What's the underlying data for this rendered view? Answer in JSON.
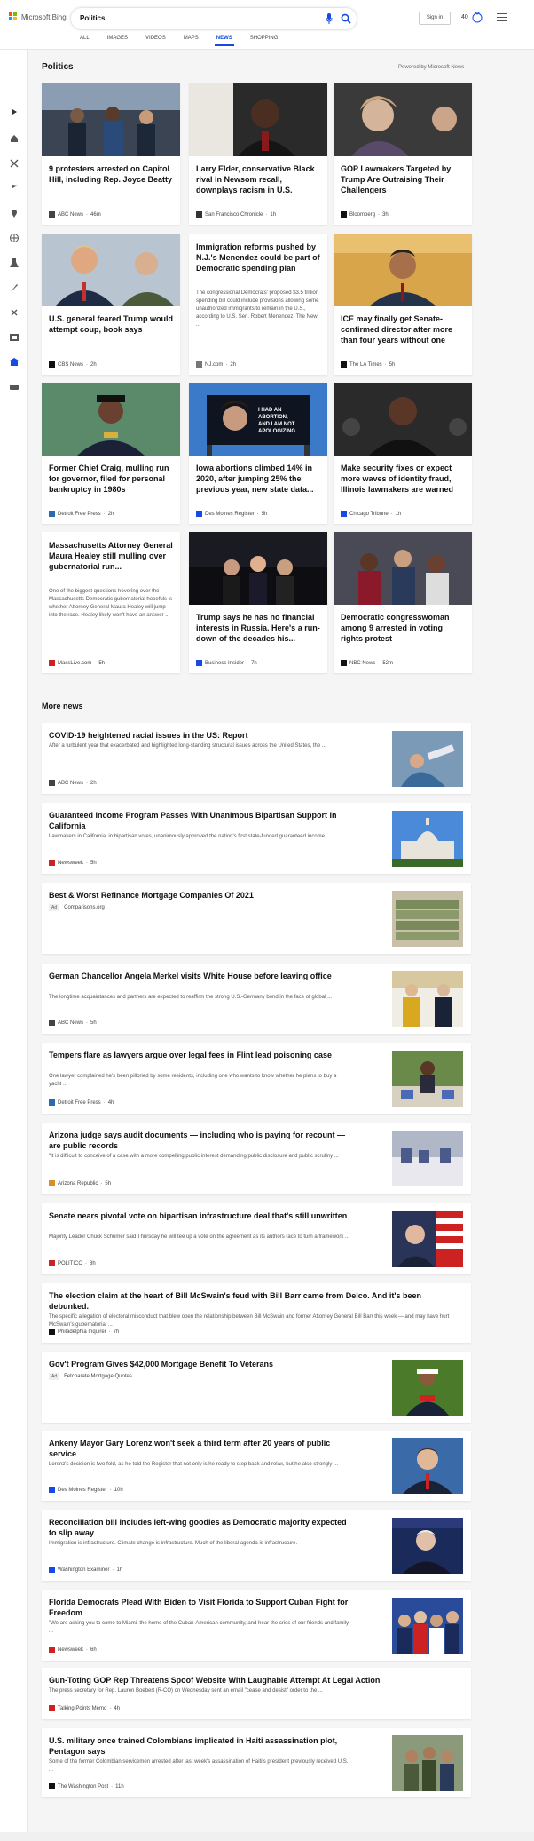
{
  "header": {
    "brand": "Microsoft Bing",
    "query": "Politics",
    "signin": "Sign in",
    "points": "40",
    "tabs": [
      "ALL",
      "IMAGES",
      "VIDEOS",
      "MAPS",
      "NEWS",
      "SHOPPING"
    ],
    "active_tab": "NEWS"
  },
  "colors": {
    "accent": "#174ae4"
  },
  "sidebar_icons": [
    "arrow-right-icon",
    "home-icon",
    "world-icon",
    "flag-icon",
    "location-icon",
    "globe-icon",
    "science-icon",
    "rocket-icon",
    "sports-icon",
    "tv-icon",
    "politics-icon",
    "money-icon"
  ],
  "section": {
    "title": "Politics",
    "powered": "Powered by Microsoft News"
  },
  "cards": [
    {
      "title": "9 protesters arrested on Capitol Hill, including Rep. Joyce Beatty",
      "source": "ABC News",
      "time": "46m"
    },
    {
      "title": "Larry Elder, conservative Black rival in Newsom recall, downplays racism in U.S.",
      "source": "San Francisco Chronicle",
      "time": "1h"
    },
    {
      "title": "GOP Lawmakers Targeted by Trump Are Outraising Their Challengers",
      "source": "Bloomberg",
      "time": "3h"
    },
    {
      "title": "U.S. general feared Trump would attempt coup, book says",
      "source": "CBS News",
      "time": "2h"
    },
    {
      "title": "Immigration reforms pushed by N.J.'s Menendez could be part of Democratic spending plan",
      "snippet": "The congressional Democrats' proposed $3.5 trillion spending bill could include provisions allowing some unauthorized immigrants to remain in the U.S., according to U.S. Sen. Robert Menendez. The New ...",
      "source": "NJ.com",
      "time": "2h"
    },
    {
      "title": "ICE may finally get Senate-confirmed director after more than four years without one",
      "source": "The LA Times",
      "time": "5h"
    },
    {
      "title": "Former Chief Craig, mulling run for governor, filed for personal bankruptcy in 1980s",
      "source": "Detroit Free Press",
      "time": "2h"
    },
    {
      "title": "Iowa abortions climbed 14% in 2020, after jumping 25% the previous year, new state data...",
      "source": "Des Moines Register",
      "time": "5h",
      "billboard": "I HAD AN ABORTION, AND I AM NOT APOLOGIZING."
    },
    {
      "title": "Make security fixes or expect more waves of identity fraud, Illinois lawmakers are warned",
      "source": "Chicago Tribune",
      "time": "1h"
    },
    {
      "title": "Massachusetts Attorney General Maura Healey still mulling over gubernatorial run...",
      "snippet": "One of the biggest questions hovering over the Massachusetts Democratic gubernatorial hopefuls is whether Attorney General Maura Healey will jump into the race. Healey likely won't have an answer ...",
      "source": "MassLive.com",
      "time": "5h"
    },
    {
      "title": "Trump says he has no financial interests in Russia. Here's a run-down of the decades his...",
      "source": "Business Insider",
      "time": "7h"
    },
    {
      "title": "Democratic congresswoman among 9 arrested in voting rights protest",
      "source": "NBC News",
      "time": "52m"
    }
  ],
  "more_news": {
    "title": "More news",
    "items": [
      {
        "title": "COVID-19 heightened racial issues in the US: Report",
        "snippet": "After a turbulent year that exacerbated and highlighted long-standing structural issues across the United States, the ...",
        "source": "ABC News",
        "time": "2h"
      },
      {
        "title": "Guaranteed Income Program Passes With Unanimous Bipartisan Support in California",
        "snippet": "Lawmakers in California, in bipartisan votes, unanimously approved the nation's first state-funded guaranteed income ...",
        "source": "Newsweek",
        "time": "5h"
      },
      {
        "title": "Best & Worst Refinance Mortgage Companies Of 2021",
        "ad": "Ad",
        "source": "Comparisons.org"
      },
      {
        "title": "German Chancellor Angela Merkel visits White House before leaving office",
        "snippet": "The longtime acquaintances and partners are expected to reaffirm the strong U.S.-Germany bond in the face of global ...",
        "source": "ABC News",
        "time": "5h"
      },
      {
        "title": "Tempers flare as lawyers argue over legal fees in Flint lead poisoning case",
        "snippet": "One lawyer complained he's been pilloried by some residents, including one who wants to know whether he plans to buy a yacht ...",
        "source": "Detroit Free Press",
        "time": "4h"
      },
      {
        "title": "Arizona judge says audit documents — including who is paying for recount — are public records",
        "snippet": "\"It is difficult to conceive of a case with a more compelling public interest demanding public disclosure and public scrutiny ...",
        "source": "Arizona Republic",
        "time": "5h"
      },
      {
        "title": "Senate nears pivotal vote on bipartisan infrastructure deal that's still unwritten",
        "snippet": "Majority Leader Chuck Schumer said Thursday he will tee up a vote on the agreement as its authors race to turn a framework ...",
        "source": "POLITICO",
        "time": "8h"
      },
      {
        "title": "The election claim at the heart of Bill McSwain's feud with Bill Barr came from Delco. And it's been debunked.",
        "snippet": "The specific allegation of electoral misconduct that blew open the relationship between Bill McSwain and former Attorney General Bill Barr this week — and may have hurt McSwain's gubernatorial ...",
        "source": "Philadelphia Inquirer",
        "time": "7h"
      },
      {
        "title": "Gov't Program Gives $42,000 Mortgage Benefit To Veterans",
        "ad": "Ad",
        "source": "Fetcharate Mortgage Quotes"
      },
      {
        "title": "Ankeny Mayor Gary Lorenz won't seek a third term after 20 years of public service",
        "snippet": "Lorenz's decision is two-fold, as he told the Register that not only is he ready to step back and relax, but he also strongly ...",
        "source": "Des Moines Register",
        "time": "10h"
      },
      {
        "title": "Reconciliation bill includes left-wing goodies as Democratic majority expected to slip away",
        "snippet": "Immigration is infrastructure. Climate change is infrastructure. Much of the liberal agenda is infrastructure.",
        "source": "Washington Examiner",
        "time": "1h"
      },
      {
        "title": "Florida Democrats Plead With Biden to Visit Florida to Support Cuban Fight for Freedom",
        "snippet": "\"We are asking you to come to Miami, the home of the Cuban-American community, and hear the cries of our friends and family ...",
        "source": "Newsweek",
        "time": "6h"
      },
      {
        "title": "Gun-Toting GOP Rep Threatens Spoof Website With Laughable Attempt At Legal Action",
        "snippet": "The press secretary for Rep. Lauren Boebert (R-CO) on Wednesday sent an email \"cease and desist\" order to the ...",
        "source": "Talking Points Memo",
        "time": "4h"
      },
      {
        "title": "U.S. military once trained Colombians implicated in Haiti assassination plot, Pentagon says",
        "snippet": "Some of the former Colombian servicemen arrested after last week's assassination of Haiti's president previously received U.S. ...",
        "source": "The Washington Post",
        "time": "11h"
      }
    ]
  }
}
